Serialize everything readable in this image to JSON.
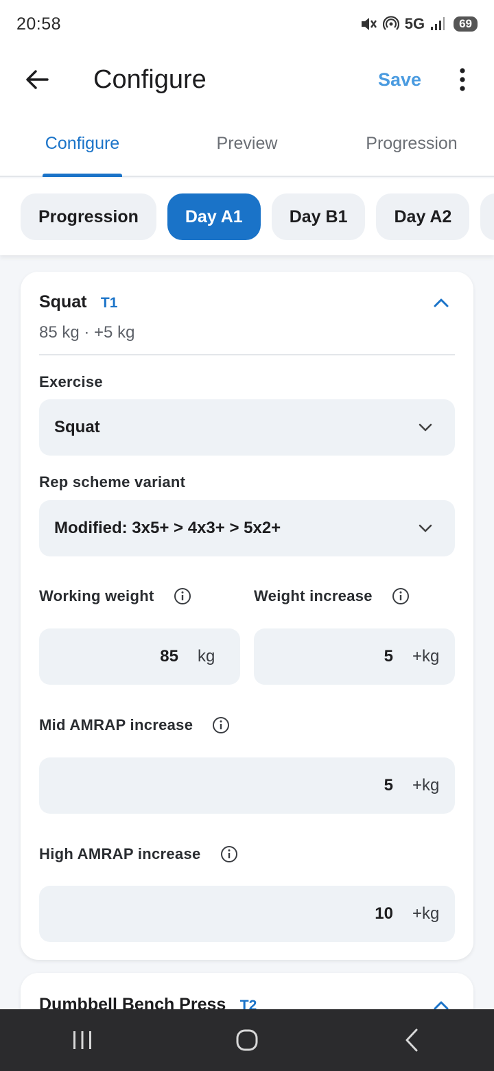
{
  "status_bar": {
    "time": "20:58",
    "network": "5G",
    "battery": "69"
  },
  "app_bar": {
    "title": "Configure",
    "save_label": "Save"
  },
  "tabs": [
    {
      "label": "Configure",
      "active": true
    },
    {
      "label": "Preview",
      "active": false
    },
    {
      "label": "Progression",
      "active": false
    }
  ],
  "chips": [
    {
      "label": "Progression",
      "active": false
    },
    {
      "label": "Day A1",
      "active": true
    },
    {
      "label": "Day B1",
      "active": false
    },
    {
      "label": "Day A2",
      "active": false
    }
  ],
  "exercise_card": {
    "name": "Squat",
    "tier": "T1",
    "summary": "85 kg · +5 kg",
    "exercise_label": "Exercise",
    "exercise_value": "Squat",
    "rep_scheme_label": "Rep scheme variant",
    "rep_scheme_value": "Modified: 3x5+ > 4x3+ > 5x2+",
    "working_weight_label": "Working weight",
    "working_weight_value": "85",
    "working_weight_unit": "kg",
    "weight_increase_label": "Weight increase",
    "weight_increase_value": "5",
    "weight_increase_unit": "+kg",
    "mid_amrap_label": "Mid AMRAP increase",
    "mid_amrap_value": "5",
    "mid_amrap_unit": "+kg",
    "high_amrap_label": "High AMRAP increase",
    "high_amrap_value": "10",
    "high_amrap_unit": "+kg"
  },
  "exercise_card_2": {
    "name": "Dumbbell Bench Press",
    "tier": "T2"
  },
  "colors": {
    "accent": "#1a73c8",
    "save": "#4a9be0",
    "field_bg": "#eef2f6"
  }
}
